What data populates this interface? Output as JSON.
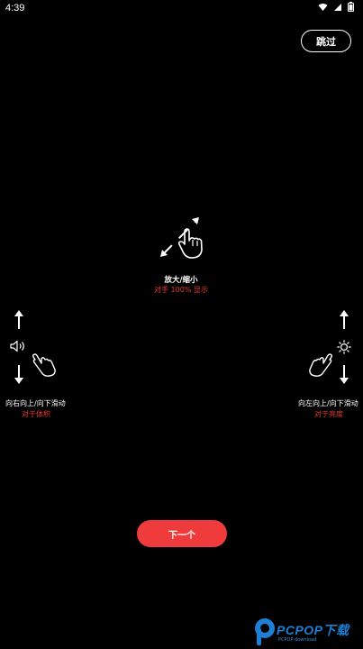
{
  "status_bar": {
    "time": "4:39",
    "icons": [
      "wifi-icon",
      "signal-icon",
      "battery-icon"
    ]
  },
  "header": {
    "skip_label": "跳过"
  },
  "center_hint": {
    "icon": "pinch-zoom-icon",
    "title": "放大/缩小",
    "subtitle": "对手 100% 显示"
  },
  "left_hint": {
    "icons": [
      "arrow-up-icon",
      "volume-icon",
      "arrow-down-icon",
      "swipe-hand-icon"
    ],
    "title": "向右向上/向下滑动",
    "subtitle": "对于体积"
  },
  "right_hint": {
    "icons": [
      "arrow-up-icon",
      "brightness-icon",
      "arrow-down-icon",
      "swipe-hand-icon"
    ],
    "title": "向左向上/向下滑动",
    "subtitle": "对于亮度"
  },
  "footer": {
    "next_label": "下一个"
  },
  "watermark": {
    "brand": "PCPOP下载",
    "sub": "PCPOP download"
  },
  "colors": {
    "background": "#000000",
    "accent": "#ef3b3b",
    "sub_text": "#e53935",
    "watermark": "#1d7fd6"
  }
}
